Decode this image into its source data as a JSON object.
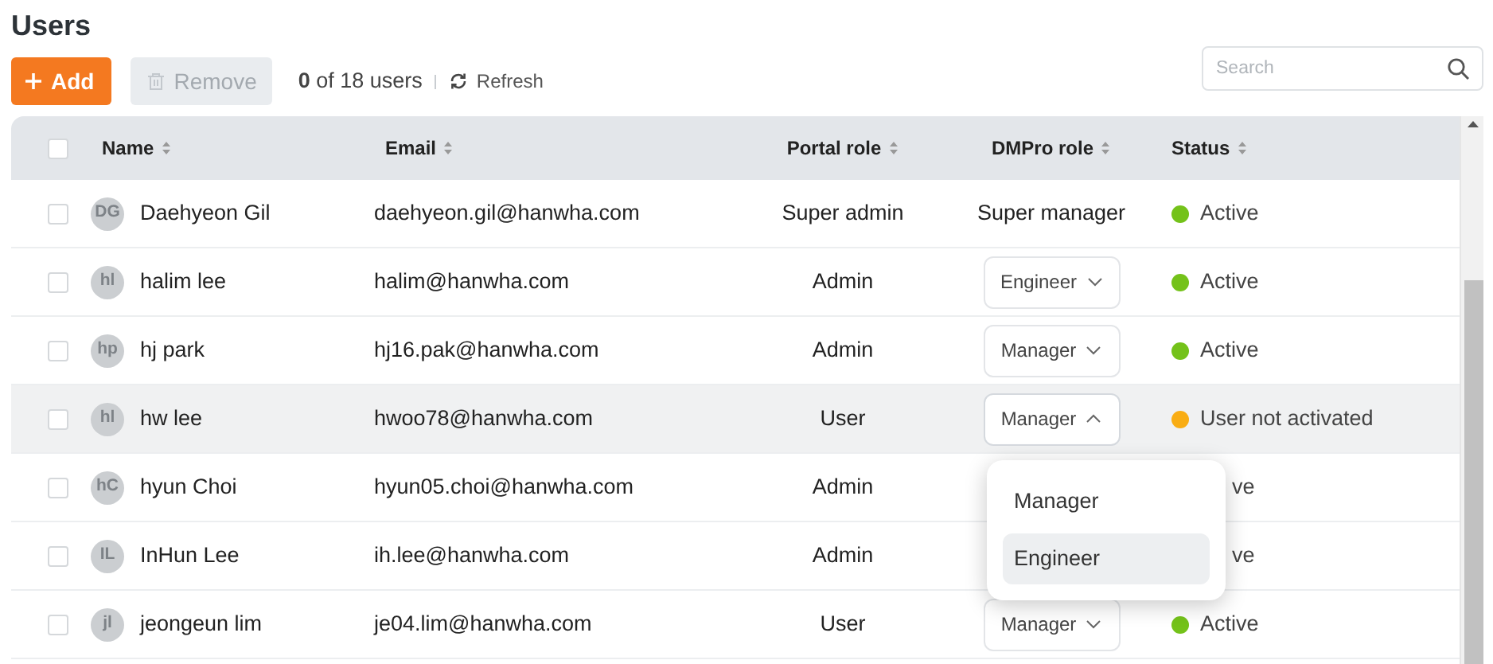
{
  "page": {
    "title": "Users"
  },
  "toolbar": {
    "add_button": "Add",
    "remove_button": {
      "label": "Remove",
      "disabled": true
    },
    "count": "**0** of 18 users",
    "refresh": "Refresh",
    "search": {
      "placeholder": "Search"
    }
  },
  "table": {
    "select_all": {
      "checked": false
    },
    "columns": [
      "Name",
      "Email",
      "Portal role",
      "DMPro role",
      "Status"
    ],
    "rows": [
      {
        "initials": "DG",
        "name": "Daehyeon Gil",
        "email": "daehyeon.gil@hanwha.com",
        "portal_role": "Super admin",
        "dmpro_role": {
          "kind": "text",
          "value": "Super manager"
        },
        "status": {
          "text": "Active",
          "color": "#74c21a"
        },
        "checked": false,
        "hovered": false
      },
      {
        "initials": "hl",
        "name": "halim lee",
        "email": "halim@hanwha.com",
        "portal_role": "Admin",
        "dmpro_role": {
          "kind": "select",
          "value": "Engineer",
          "expanded": false
        },
        "status": {
          "text": "Active",
          "color": "#74c21a"
        },
        "checked": false,
        "hovered": false
      },
      {
        "initials": "hp",
        "name": "hj park",
        "email": "hj16.pak@hanwha.com",
        "portal_role": "Admin",
        "dmpro_role": {
          "kind": "select",
          "value": "Manager",
          "expanded": false
        },
        "status": {
          "text": "Active",
          "color": "#74c21a"
        },
        "checked": false,
        "hovered": false
      },
      {
        "initials": "hl",
        "name": "hw lee",
        "email": "hwoo78@hanwha.com",
        "portal_role": "User",
        "dmpro_role": {
          "kind": "select",
          "value": "Manager",
          "expanded": true,
          "options": [
            {
              "label": "Manager",
              "highlighted": false
            },
            {
              "label": "Engineer",
              "highlighted": true
            }
          ]
        },
        "status": {
          "text": "User not activated",
          "color": "#f9ad14"
        },
        "checked": false,
        "hovered": true
      },
      {
        "initials": "hC",
        "name": "hyun Choi",
        "email": "hyun05.choi@hanwha.com",
        "portal_role": "Admin",
        "status": {
          "text": "ve"
        },
        "checked": false,
        "hovered": false
      },
      {
        "initials": "IL",
        "name": "InHun Lee",
        "email": "ih.lee@hanwha.com",
        "portal_role": "Admin",
        "status": {
          "text": "ve"
        },
        "checked": false,
        "hovered": false
      },
      {
        "initials": "jl",
        "name": "jeongeun lim",
        "email": "je04.lim@hanwha.com",
        "portal_role": "User",
        "dmpro_role": {
          "kind": "select",
          "value": "Manager",
          "expanded": false
        },
        "status": {
          "text": "Active",
          "color": "#74c21a"
        },
        "checked": false,
        "hovered": false
      }
    ]
  }
}
